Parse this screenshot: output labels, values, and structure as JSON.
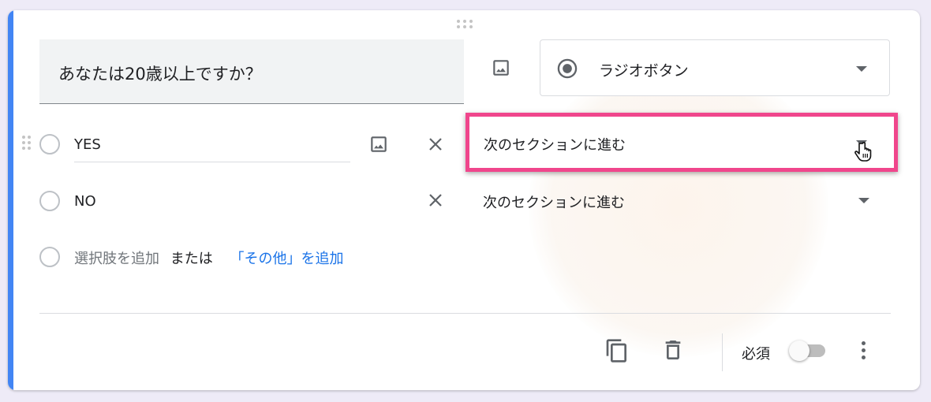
{
  "question": {
    "title": "あなたは20歳以上ですか？",
    "type_label": "ラジオボタン",
    "options": [
      {
        "label": "YES",
        "goto": "次のセクションに進む"
      },
      {
        "label": "NO",
        "goto": "次のセクションに進む"
      }
    ],
    "add_option": {
      "text": "選択肢を追加",
      "or": "または",
      "add_other": "「その他」を追加"
    }
  },
  "footer": {
    "required_label": "必須",
    "required_on": false
  },
  "colors": {
    "accent": "#4285f4",
    "highlight": "#f0468c",
    "link": "#1a73e8"
  },
  "icons": [
    "drag-handle-icon",
    "image-icon",
    "radio-button-icon",
    "chevron-down-icon",
    "close-icon",
    "copy-icon",
    "delete-icon",
    "more-vert-icon",
    "hand-cursor-icon"
  ]
}
